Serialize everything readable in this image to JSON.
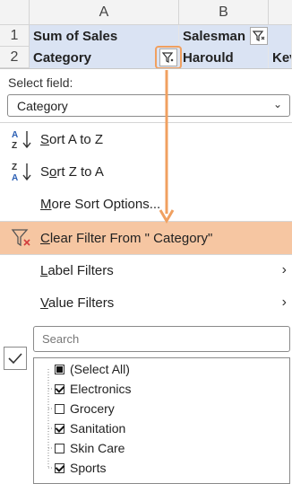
{
  "sheet": {
    "col_a": "A",
    "col_b": "B",
    "row1": "1",
    "row2": "2",
    "a1": "Sum of Sales",
    "b1": "Salesman",
    "a2": "Category",
    "b2": "Harould",
    "c2": "Kev"
  },
  "menu": {
    "select_field_label": "Select field:",
    "select_field_value": "Category",
    "sort_az": "Sort A to Z",
    "sort_za": "Sort Z to A",
    "more_sort": "More Sort Options...",
    "clear_filter": "Clear Filter From \" Category\"",
    "label_filters": "Label Filters",
    "value_filters": "Value Filters",
    "search_placeholder": "Search"
  },
  "filter_items": [
    {
      "label": "(Select All)",
      "state": "partial"
    },
    {
      "label": "Electronics",
      "state": "checked"
    },
    {
      "label": "Grocery",
      "state": "unchecked"
    },
    {
      "label": "Sanitation",
      "state": "checked"
    },
    {
      "label": "Skin Care",
      "state": "unchecked"
    },
    {
      "label": "Sports",
      "state": "checked"
    }
  ],
  "colors": {
    "highlight": "#f6c6a2",
    "accent_orange": "#f0a060",
    "pivot_header_blue": "#dae3f3"
  },
  "icons": [
    "filter-icon",
    "sort-az-icon",
    "sort-za-icon",
    "clear-filter-icon",
    "chevron-right-icon",
    "check-icon",
    "chevron-down-icon"
  ]
}
